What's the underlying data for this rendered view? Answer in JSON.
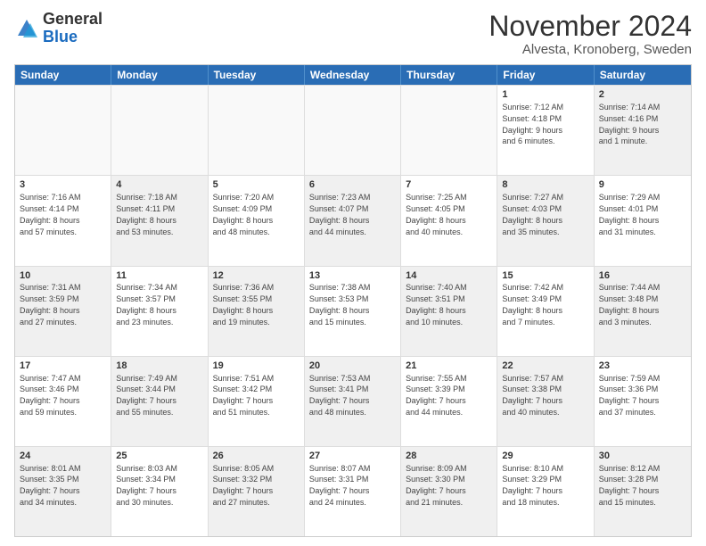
{
  "logo": {
    "general": "General",
    "blue": "Blue"
  },
  "title": "November 2024",
  "location": "Alvesta, Kronoberg, Sweden",
  "header_days": [
    "Sunday",
    "Monday",
    "Tuesday",
    "Wednesday",
    "Thursday",
    "Friday",
    "Saturday"
  ],
  "rows": [
    [
      {
        "day": "",
        "text": "",
        "empty": true
      },
      {
        "day": "",
        "text": "",
        "empty": true
      },
      {
        "day": "",
        "text": "",
        "empty": true
      },
      {
        "day": "",
        "text": "",
        "empty": true
      },
      {
        "day": "",
        "text": "",
        "empty": true
      },
      {
        "day": "1",
        "text": "Sunrise: 7:12 AM\nSunset: 4:18 PM\nDaylight: 9 hours\nand 6 minutes.",
        "empty": false
      },
      {
        "day": "2",
        "text": "Sunrise: 7:14 AM\nSunset: 4:16 PM\nDaylight: 9 hours\nand 1 minute.",
        "empty": false,
        "shaded": true
      }
    ],
    [
      {
        "day": "3",
        "text": "Sunrise: 7:16 AM\nSunset: 4:14 PM\nDaylight: 8 hours\nand 57 minutes.",
        "empty": false
      },
      {
        "day": "4",
        "text": "Sunrise: 7:18 AM\nSunset: 4:11 PM\nDaylight: 8 hours\nand 53 minutes.",
        "empty": false,
        "shaded": true
      },
      {
        "day": "5",
        "text": "Sunrise: 7:20 AM\nSunset: 4:09 PM\nDaylight: 8 hours\nand 48 minutes.",
        "empty": false
      },
      {
        "day": "6",
        "text": "Sunrise: 7:23 AM\nSunset: 4:07 PM\nDaylight: 8 hours\nand 44 minutes.",
        "empty": false,
        "shaded": true
      },
      {
        "day": "7",
        "text": "Sunrise: 7:25 AM\nSunset: 4:05 PM\nDaylight: 8 hours\nand 40 minutes.",
        "empty": false
      },
      {
        "day": "8",
        "text": "Sunrise: 7:27 AM\nSunset: 4:03 PM\nDaylight: 8 hours\nand 35 minutes.",
        "empty": false,
        "shaded": true
      },
      {
        "day": "9",
        "text": "Sunrise: 7:29 AM\nSunset: 4:01 PM\nDaylight: 8 hours\nand 31 minutes.",
        "empty": false
      }
    ],
    [
      {
        "day": "10",
        "text": "Sunrise: 7:31 AM\nSunset: 3:59 PM\nDaylight: 8 hours\nand 27 minutes.",
        "empty": false,
        "shaded": true
      },
      {
        "day": "11",
        "text": "Sunrise: 7:34 AM\nSunset: 3:57 PM\nDaylight: 8 hours\nand 23 minutes.",
        "empty": false
      },
      {
        "day": "12",
        "text": "Sunrise: 7:36 AM\nSunset: 3:55 PM\nDaylight: 8 hours\nand 19 minutes.",
        "empty": false,
        "shaded": true
      },
      {
        "day": "13",
        "text": "Sunrise: 7:38 AM\nSunset: 3:53 PM\nDaylight: 8 hours\nand 15 minutes.",
        "empty": false
      },
      {
        "day": "14",
        "text": "Sunrise: 7:40 AM\nSunset: 3:51 PM\nDaylight: 8 hours\nand 10 minutes.",
        "empty": false,
        "shaded": true
      },
      {
        "day": "15",
        "text": "Sunrise: 7:42 AM\nSunset: 3:49 PM\nDaylight: 8 hours\nand 7 minutes.",
        "empty": false
      },
      {
        "day": "16",
        "text": "Sunrise: 7:44 AM\nSunset: 3:48 PM\nDaylight: 8 hours\nand 3 minutes.",
        "empty": false,
        "shaded": true
      }
    ],
    [
      {
        "day": "17",
        "text": "Sunrise: 7:47 AM\nSunset: 3:46 PM\nDaylight: 7 hours\nand 59 minutes.",
        "empty": false
      },
      {
        "day": "18",
        "text": "Sunrise: 7:49 AM\nSunset: 3:44 PM\nDaylight: 7 hours\nand 55 minutes.",
        "empty": false,
        "shaded": true
      },
      {
        "day": "19",
        "text": "Sunrise: 7:51 AM\nSunset: 3:42 PM\nDaylight: 7 hours\nand 51 minutes.",
        "empty": false
      },
      {
        "day": "20",
        "text": "Sunrise: 7:53 AM\nSunset: 3:41 PM\nDaylight: 7 hours\nand 48 minutes.",
        "empty": false,
        "shaded": true
      },
      {
        "day": "21",
        "text": "Sunrise: 7:55 AM\nSunset: 3:39 PM\nDaylight: 7 hours\nand 44 minutes.",
        "empty": false
      },
      {
        "day": "22",
        "text": "Sunrise: 7:57 AM\nSunset: 3:38 PM\nDaylight: 7 hours\nand 40 minutes.",
        "empty": false,
        "shaded": true
      },
      {
        "day": "23",
        "text": "Sunrise: 7:59 AM\nSunset: 3:36 PM\nDaylight: 7 hours\nand 37 minutes.",
        "empty": false
      }
    ],
    [
      {
        "day": "24",
        "text": "Sunrise: 8:01 AM\nSunset: 3:35 PM\nDaylight: 7 hours\nand 34 minutes.",
        "empty": false,
        "shaded": true
      },
      {
        "day": "25",
        "text": "Sunrise: 8:03 AM\nSunset: 3:34 PM\nDaylight: 7 hours\nand 30 minutes.",
        "empty": false
      },
      {
        "day": "26",
        "text": "Sunrise: 8:05 AM\nSunset: 3:32 PM\nDaylight: 7 hours\nand 27 minutes.",
        "empty": false,
        "shaded": true
      },
      {
        "day": "27",
        "text": "Sunrise: 8:07 AM\nSunset: 3:31 PM\nDaylight: 7 hours\nand 24 minutes.",
        "empty": false
      },
      {
        "day": "28",
        "text": "Sunrise: 8:09 AM\nSunset: 3:30 PM\nDaylight: 7 hours\nand 21 minutes.",
        "empty": false,
        "shaded": true
      },
      {
        "day": "29",
        "text": "Sunrise: 8:10 AM\nSunset: 3:29 PM\nDaylight: 7 hours\nand 18 minutes.",
        "empty": false
      },
      {
        "day": "30",
        "text": "Sunrise: 8:12 AM\nSunset: 3:28 PM\nDaylight: 7 hours\nand 15 minutes.",
        "empty": false,
        "shaded": true
      }
    ]
  ]
}
